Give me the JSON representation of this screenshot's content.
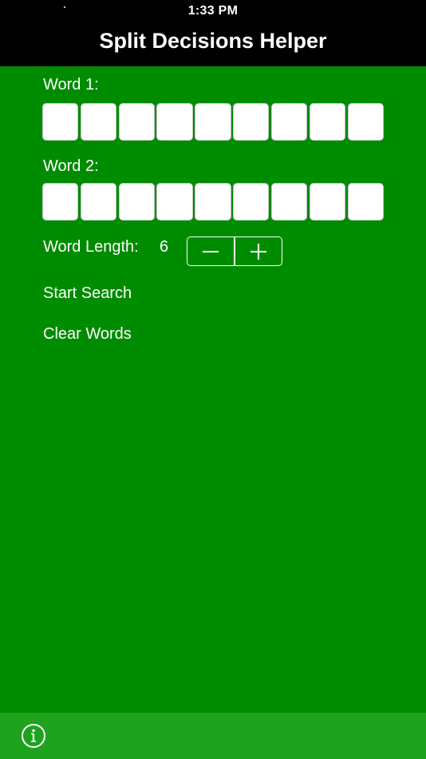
{
  "status_bar": {
    "time": "1:33 PM"
  },
  "nav": {
    "title": "Split Decisions Helper"
  },
  "word1": {
    "label": "Word 1:",
    "letters": [
      "",
      "",
      "",
      "",
      "",
      "",
      "",
      "",
      ""
    ]
  },
  "word2": {
    "label": "Word 2:",
    "letters": [
      "",
      "",
      "",
      "",
      "",
      "",
      "",
      "",
      ""
    ]
  },
  "word_length": {
    "label": "Word Length:",
    "value": "6",
    "decrement_symbol": "−",
    "increment_symbol": "+"
  },
  "actions": {
    "start_search": "Start Search",
    "clear_words": "Clear Words"
  },
  "toolbar": {
    "info_icon": "info-icon"
  },
  "colors": {
    "background": "#008c00",
    "bottom_bar": "#1da31d",
    "nav_background": "#000000",
    "text": "#ffffff"
  }
}
